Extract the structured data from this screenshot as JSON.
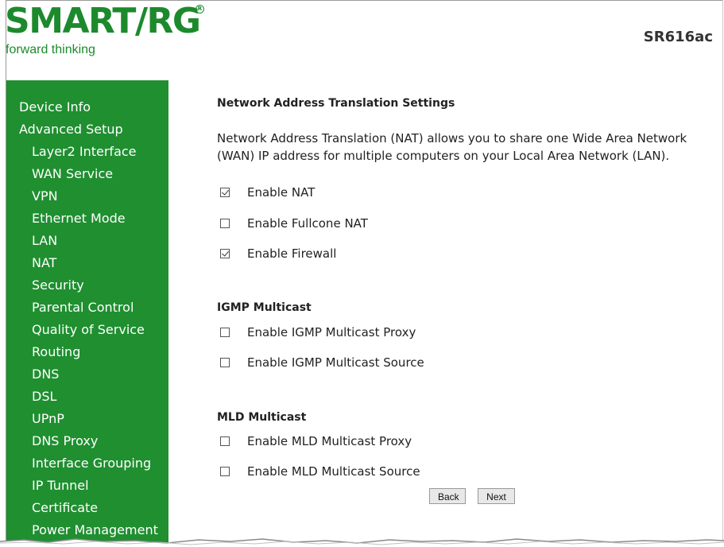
{
  "brand": {
    "logo_text": "SMART/RG",
    "tagline": "forward thinking",
    "model": "SR616ac",
    "green": "#1c8a2c"
  },
  "sidebar": {
    "background": "#1f8f30",
    "items": [
      {
        "label": "Device Info",
        "level": 1
      },
      {
        "label": "Advanced Setup",
        "level": 1
      },
      {
        "label": "Layer2 Interface",
        "level": 2
      },
      {
        "label": "WAN Service",
        "level": 2
      },
      {
        "label": "VPN",
        "level": 2
      },
      {
        "label": "Ethernet Mode",
        "level": 2
      },
      {
        "label": "LAN",
        "level": 2
      },
      {
        "label": "NAT",
        "level": 2
      },
      {
        "label": "Security",
        "level": 2
      },
      {
        "label": "Parental Control",
        "level": 2
      },
      {
        "label": "Quality of Service",
        "level": 2
      },
      {
        "label": "Routing",
        "level": 2
      },
      {
        "label": "DNS",
        "level": 2
      },
      {
        "label": "DSL",
        "level": 2
      },
      {
        "label": "UPnP",
        "level": 2
      },
      {
        "label": "DNS Proxy",
        "level": 2
      },
      {
        "label": "Interface Grouping",
        "level": 2
      },
      {
        "label": "IP Tunnel",
        "level": 2
      },
      {
        "label": "Certificate",
        "level": 2
      },
      {
        "label": "Power Management",
        "level": 2
      }
    ]
  },
  "main": {
    "nat_title": "Network Address Translation Settings",
    "nat_description": "Network Address Translation (NAT) allows you to share one Wide Area Network (WAN) IP address for multiple computers on your Local Area Network (LAN).",
    "nat_options": [
      {
        "label": "Enable NAT",
        "checked": true
      },
      {
        "label": "Enable Fullcone NAT",
        "checked": false
      },
      {
        "label": "Enable Firewall",
        "checked": true
      }
    ],
    "igmp_title": "IGMP Multicast",
    "igmp_options": [
      {
        "label": "Enable IGMP Multicast Proxy",
        "checked": false
      },
      {
        "label": "Enable IGMP Multicast Source",
        "checked": false
      }
    ],
    "mld_title": "MLD Multicast",
    "mld_options": [
      {
        "label": "Enable MLD Multicast Proxy",
        "checked": false
      },
      {
        "label": "Enable MLD Multicast Source",
        "checked": false
      }
    ],
    "back_label": "Back",
    "next_label": "Next"
  }
}
